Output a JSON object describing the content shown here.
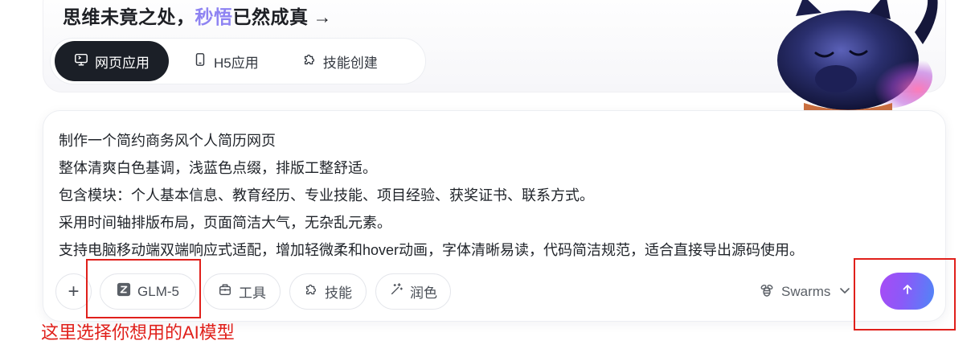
{
  "headline": {
    "part1": "思维未竟之处，",
    "accent": "秒悟",
    "part2": "已然成真",
    "arrow": "→"
  },
  "mode_tabs": [
    {
      "label": "网页应用",
      "icon": "monitor-icon",
      "active": true
    },
    {
      "label": "H5应用",
      "icon": "phone-icon",
      "active": false
    },
    {
      "label": "技能创建",
      "icon": "puzzle-icon",
      "active": false
    }
  ],
  "prompt": {
    "lines": [
      "制作一个简约商务风个人简历网页",
      "整体清爽白色基调，浅蓝色点缀，排版工整舒适。",
      "包含模块：个人基本信息、教育经历、专业技能、项目经验、获奖证书、联系方式。",
      "采用时间轴排版布局，页面简洁大气，无杂乱元素。",
      "支持电脑移动端双端响应式适配，增加轻微柔和hover动画，字体清晰易读，代码简洁规范，适合直接导出源码使用。"
    ]
  },
  "toolbar": {
    "plus": "+",
    "model": "GLM-5",
    "tools": "工具",
    "skills": "技能",
    "polish": "润色",
    "swarms": "Swarms"
  },
  "annotation": {
    "text": "这里选择你想用的AI模型"
  },
  "colors": {
    "accent": "#8e83f2",
    "active_tab": "#1b1f27",
    "annotation": "#e0201b",
    "send_gradient_start": "#a84bf5",
    "send_gradient_end": "#4f86f7"
  }
}
